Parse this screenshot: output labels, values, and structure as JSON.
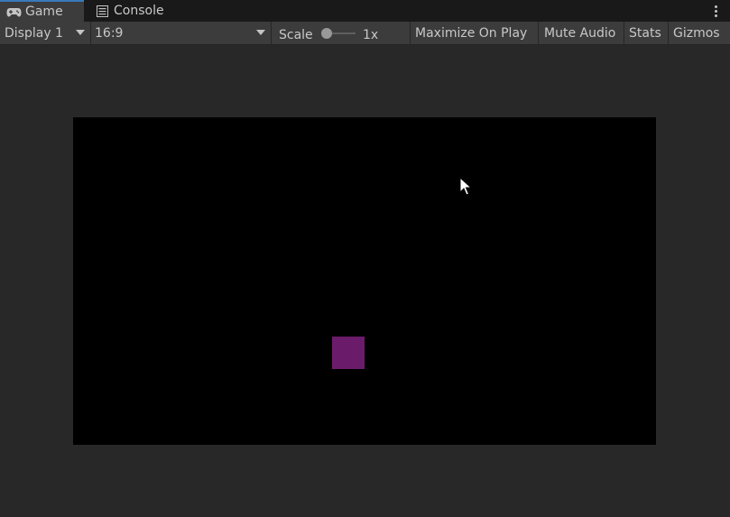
{
  "tabs": {
    "game": {
      "label": "Game",
      "icon": "gamepad-icon"
    },
    "console": {
      "label": "Console",
      "icon": "console-icon"
    }
  },
  "toolbar": {
    "display": "Display 1",
    "aspect": "16:9",
    "scale_label": "Scale",
    "scale_value": "1x",
    "scale_level": 0.0,
    "maximize": "Maximize On Play",
    "mute": "Mute Audio",
    "stats": "Stats",
    "gizmos": "Gizmos"
  },
  "game": {
    "background_color": "#000000",
    "sprite_color": "#6a1c6a"
  },
  "colors": {
    "accent": "#3a79bb",
    "panel": "#3c3c3c",
    "background": "#282828"
  }
}
